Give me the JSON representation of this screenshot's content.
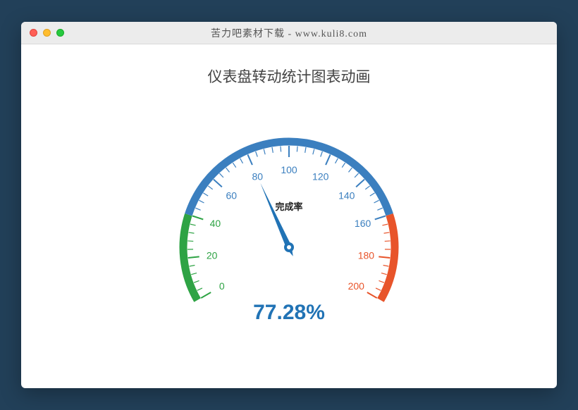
{
  "window": {
    "title": "苦力吧素材下载 - www.kuli8.com"
  },
  "page": {
    "title": "仪表盘转动统计图表动画"
  },
  "gauge": {
    "inner_label": "完成率",
    "value_percent": 77.28,
    "value_display": "77.28%",
    "startAngle": -210,
    "endAngle": 30,
    "min": 0,
    "max": 200,
    "tick_step": 20,
    "tick_labels": [
      0,
      20,
      40,
      60,
      80,
      100,
      120,
      140,
      160,
      180,
      200
    ],
    "segments": [
      {
        "from": 0,
        "to": 40,
        "color": "#2ea344"
      },
      {
        "from": 40,
        "to": 160,
        "color": "#3b7fbf"
      },
      {
        "from": 160,
        "to": 200,
        "color": "#e8542a"
      }
    ],
    "needle_value": 80,
    "needle_color": "#2173b5",
    "label_color_default": "#3b7fbf",
    "label_color_map": {
      "0": "#2ea344",
      "20": "#2ea344",
      "40": "#2ea344",
      "180": "#e8542a",
      "200": "#e8542a"
    }
  },
  "chart_data": {
    "type": "bar",
    "title": "仪表盘转动统计图表动画",
    "categories": [
      "完成率"
    ],
    "values": [
      77.28
    ],
    "ylim": [
      0,
      100
    ],
    "xlabel": "",
    "ylabel": "%"
  }
}
